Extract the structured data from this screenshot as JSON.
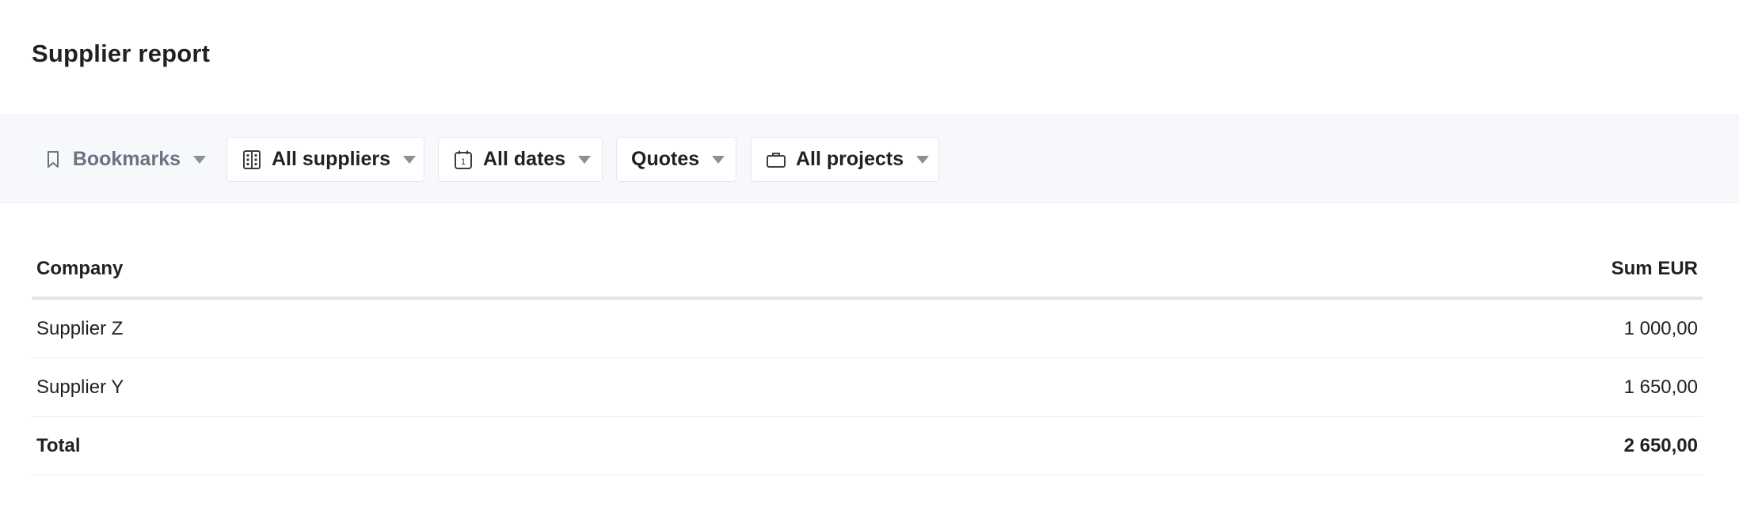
{
  "page": {
    "title": "Supplier report"
  },
  "filters": {
    "bookmarks": {
      "label": "Bookmarks",
      "icon": "bookmark-icon"
    },
    "suppliers": {
      "label": "All suppliers",
      "icon": "building-icon"
    },
    "dates": {
      "label": "All dates",
      "icon": "calendar-icon",
      "icon_text": "1"
    },
    "quotes": {
      "label": "Quotes"
    },
    "projects": {
      "label": "All projects",
      "icon": "briefcase-icon"
    }
  },
  "table": {
    "columns": {
      "company": "Company",
      "sum": "Sum EUR"
    },
    "rows": [
      {
        "company": "Supplier Z",
        "sum": "1 000,00"
      },
      {
        "company": "Supplier Y",
        "sum": "1 650,00"
      }
    ],
    "total": {
      "label": "Total",
      "sum": "2 650,00"
    }
  },
  "colors": {
    "filter_bar_bg": "#f7f8fb",
    "text": "#1f2125",
    "muted_text": "#6b7280",
    "border": "#e4e6ee"
  }
}
